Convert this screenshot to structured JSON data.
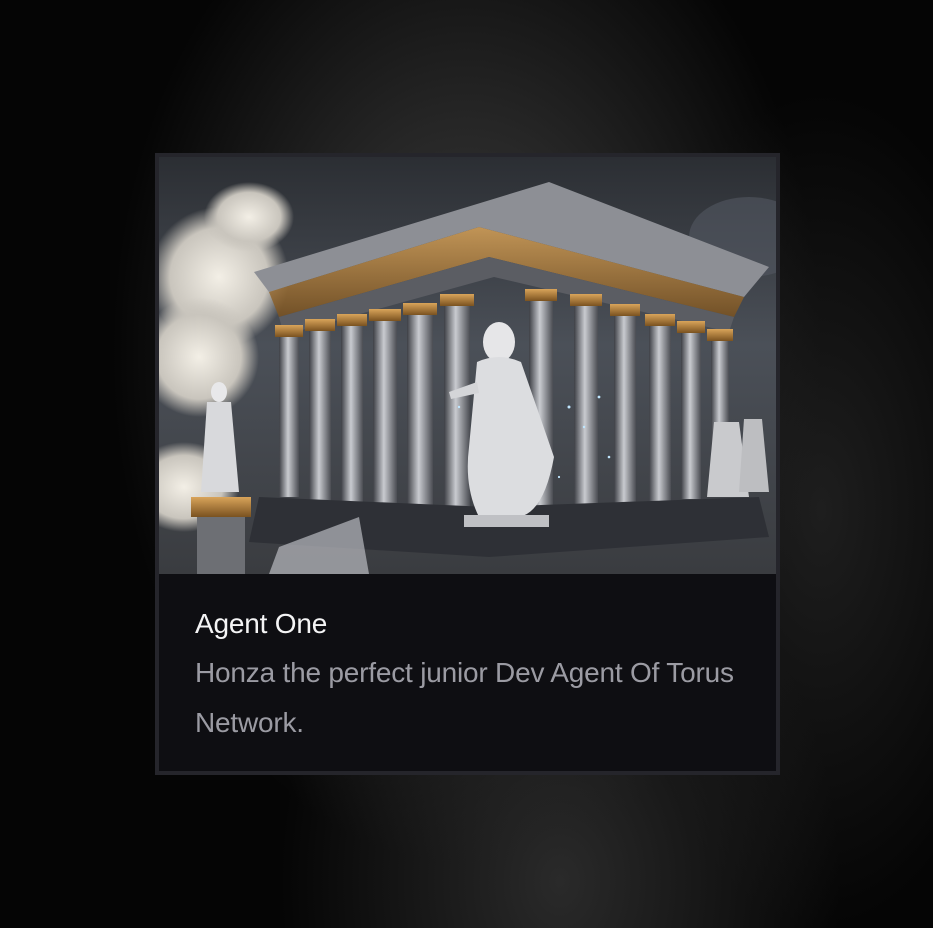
{
  "agent_card": {
    "image_alt": "Temple with marble statues among clouds",
    "title": "Agent One",
    "description": "Honza the perfect junior Dev Agent Of Torus Network."
  }
}
